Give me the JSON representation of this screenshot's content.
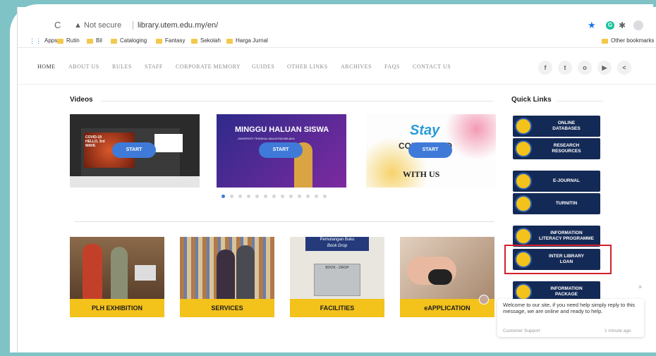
{
  "browser": {
    "reload_glyph": "C",
    "security_label": "Not secure",
    "url": "library.utem.edu.my/en/",
    "warning_icon": "warning-icon",
    "bookmark_star": "star-icon",
    "grammarly": "G",
    "bookmarks": [
      "Apps",
      "Rutin",
      "Bil",
      "Cataloging",
      "Fantasy",
      "Sekolah",
      "Harga Jurnal"
    ],
    "other_bookmarks": "Other bookmarks"
  },
  "nav": {
    "items": [
      "HOME",
      "ABOUT US",
      "RULES",
      "STAFF",
      "CORPORATE MEMORY",
      "GUIDES",
      "OTHER LINKS",
      "ARCHIVES",
      "FAQS",
      "CONTACT US"
    ],
    "social": [
      "f",
      "t",
      "o",
      "▶",
      "<"
    ]
  },
  "videos": {
    "title": "Videos",
    "start_label": "START",
    "thumb1_text": "COVID-19 HELLO, 3rd WAVE",
    "thumb2_text": "MINGGU HALUAN SISWA",
    "thumb2_sub": "UNIVERSITI TEKNIKAL MALAYSIA MELAKA",
    "thumb3_line1": "Stay",
    "thumb3_line2": "CONNECTED",
    "thumb3_line3": "WITH US",
    "dots_count": 13,
    "active_dot": 0
  },
  "tiles": [
    {
      "label": "PLH EXHIBITION"
    },
    {
      "label": "SERVICES"
    },
    {
      "label": "FACILITIES",
      "sign1": "Pemulangan Buku",
      "sign2": "Book Drop",
      "box": "BOOK - DROP"
    },
    {
      "label": "eAPPLICATION"
    }
  ],
  "quick_links": {
    "title": "Quick Links",
    "items": [
      {
        "label": "ONLINE\nDATABASES"
      },
      {
        "label": "RESEARCH\nRESOURCES"
      },
      {
        "label": "E-JOURNAL"
      },
      {
        "label": "TURNITIN"
      },
      {
        "label": "INFORMATION\nLITERACY PROGRAMME"
      },
      {
        "label": "INTER LIBRARY\nLOAN"
      },
      {
        "label": "INFORMATION\nPACKAGE"
      }
    ]
  },
  "chat": {
    "message": "Welcome to our site, if you need help simply reply to this message, we are online and ready to help.",
    "from": "Customer Support",
    "time": "1 minute ago",
    "close": "×"
  },
  "colors": {
    "accent_blue": "#3f7ad8",
    "tile_yellow": "#f3c21b",
    "quicklink_navy": "#142a56",
    "highlight_red": "#d3202b",
    "background_teal": "#7fc3c6"
  }
}
